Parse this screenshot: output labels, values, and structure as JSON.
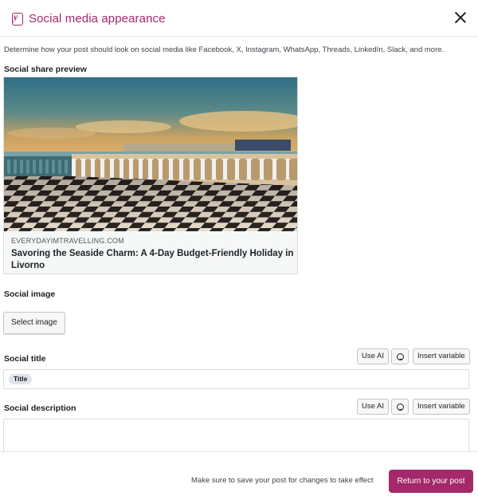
{
  "modal": {
    "title": "Social media appearance",
    "close_icon": "close-icon",
    "brand_color": "#a4286a"
  },
  "intro": "Determine how your post should look on social media like Facebook, X, Instagram, WhatsApp, Threads, LinkedIn, Slack, and more.",
  "preview": {
    "label": "Social share preview",
    "domain": "EVERYDAYIMTRAVELLING.COM",
    "title": "Savoring the Seaside Charm: A 4-Day Budget-Friendly Holiday in Livorno"
  },
  "social_image": {
    "label": "Social image",
    "select_button": "Select image"
  },
  "social_title": {
    "label": "Social title",
    "use_ai": "Use AI",
    "emoji_icon": "smiley-icon",
    "insert_variable": "Insert variable",
    "tag": "Title"
  },
  "social_description": {
    "label": "Social description",
    "use_ai": "Use AI",
    "emoji_icon": "smiley-icon",
    "insert_variable": "Insert variable",
    "value": ""
  },
  "footer": {
    "note": "Make sure to save your post for changes to take effect",
    "return_button": "Return to your post"
  }
}
